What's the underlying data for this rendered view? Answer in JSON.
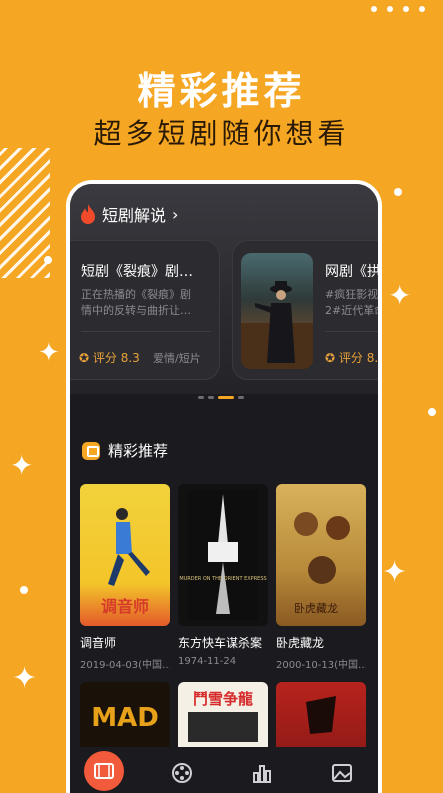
{
  "hero": {
    "title": "精彩推荐",
    "subtitle": "超多短剧随你想看"
  },
  "commentary": {
    "header": "短剧解说",
    "chevron": "›",
    "cards": [
      {
        "title": "短剧《裂痕》剧…",
        "desc_line1": "正在热播的《裂痕》剧",
        "desc_line2": "情中的反转与曲折让…",
        "rating": "评分 8.3",
        "tags": "爱情/短片"
      },
      {
        "title": "网剧《拱",
        "desc_line1": "#疯狂影视",
        "desc_line2": "2#近代革命",
        "rating": "评分 8.",
        "tags": ""
      }
    ]
  },
  "featured": {
    "header": "精彩推荐",
    "movies": [
      {
        "name": "调音师",
        "date": "2019-04-03(中国…"
      },
      {
        "name": "东方快车谋杀案",
        "date": "1974-11-24"
      },
      {
        "name": "卧虎藏龙",
        "date": "2000-10-13(中国…"
      }
    ],
    "posters_text": [
      "调音师",
      "MURDER ON THE ORIENT EXPRESS",
      "卧虎藏龙",
      "MAD",
      "鬥雪争龍"
    ]
  },
  "colors": {
    "accent": "#f5a623",
    "background": "#f5a623",
    "phone_bg": "#1b1b1f",
    "rating": "#e9a13a",
    "active_tab": "#f15a3a"
  },
  "tabs": [
    {
      "icon": "film-icon",
      "active": true
    },
    {
      "icon": "reel-icon",
      "active": false
    },
    {
      "icon": "chart-icon",
      "active": false
    },
    {
      "icon": "picture-icon",
      "active": false
    }
  ]
}
